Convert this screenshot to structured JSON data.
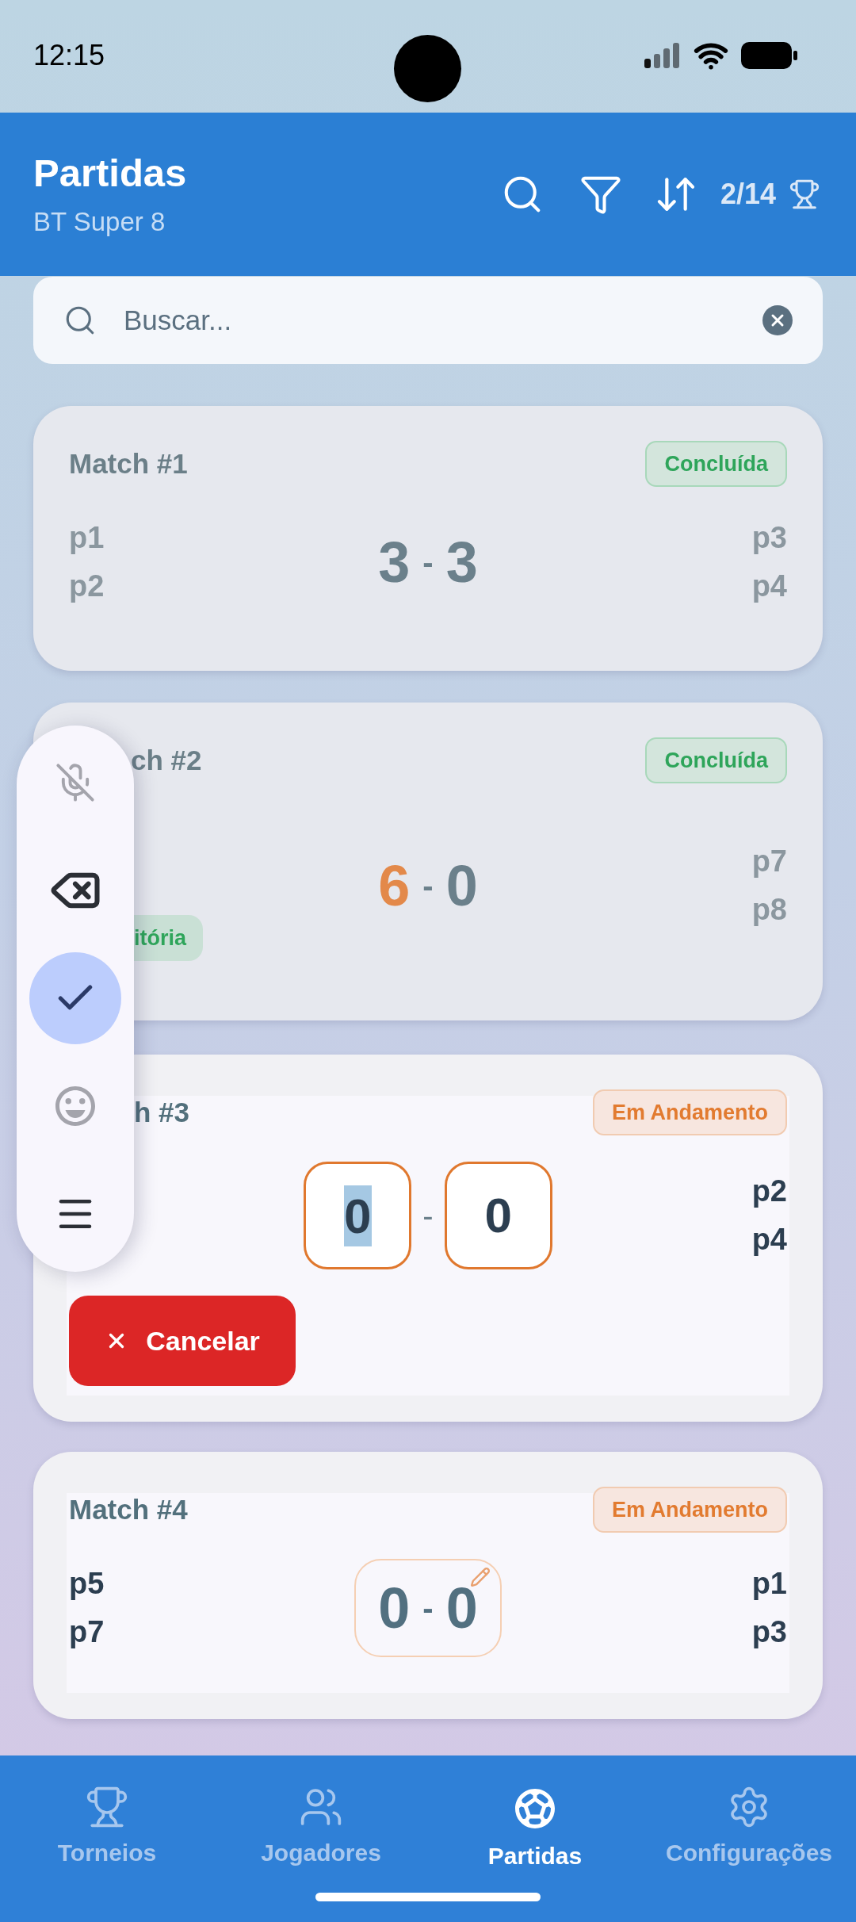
{
  "status_bar": {
    "time": "12:15"
  },
  "header": {
    "title": "Partidas",
    "subtitle": "BT Super 8",
    "counter": "2/14"
  },
  "search": {
    "placeholder": "Buscar..."
  },
  "matches": [
    {
      "title": "Match #1",
      "status": {
        "kind": "done",
        "label": "Concluída"
      },
      "left_players": [
        "p1",
        "p2"
      ],
      "right_players": [
        "p3",
        "p4"
      ],
      "score": {
        "kind": "final",
        "separator": "-",
        "left": {
          "value": "3",
          "winner": false
        },
        "right": {
          "value": "3",
          "winner": false
        }
      }
    },
    {
      "title": "ch #2",
      "status": {
        "kind": "done",
        "label": "Concluída"
      },
      "result_badge": "itória",
      "right_players": [
        "p7",
        "p8"
      ],
      "score": {
        "kind": "final",
        "separator": "-",
        "left": {
          "value": "6",
          "winner": true
        },
        "right": {
          "value": "0",
          "winner": false
        }
      }
    },
    {
      "title": "h #3",
      "status": {
        "kind": "in_progress",
        "label": "Em Andamento"
      },
      "right_players": [
        "p2",
        "p4"
      ],
      "score": {
        "kind": "editing",
        "separator": "-",
        "left": {
          "value": "0",
          "text_selected": true
        },
        "right": {
          "value": "0",
          "text_selected": false
        }
      },
      "cancel_button": "Cancelar"
    },
    {
      "title": "Match #4",
      "status": {
        "kind": "in_progress",
        "label": "Em Andamento"
      },
      "left_players": [
        "p5",
        "p7"
      ],
      "right_players": [
        "p1",
        "p3"
      ],
      "score": {
        "kind": "editable",
        "separator": "-",
        "left": {
          "value": "0"
        },
        "right": {
          "value": "0"
        }
      }
    }
  ],
  "keyboard_toolbar": {
    "buttons": [
      {
        "selected": false
      },
      {
        "selected": false
      },
      {
        "selected": true
      },
      {
        "selected": false
      },
      {
        "selected": false
      }
    ]
  },
  "bottom_nav": [
    {
      "label": "Torneios",
      "selected": false
    },
    {
      "label": "Jogadores",
      "selected": false
    },
    {
      "label": "Partidas",
      "selected": true
    },
    {
      "label": "Configurações",
      "selected": false
    }
  ]
}
